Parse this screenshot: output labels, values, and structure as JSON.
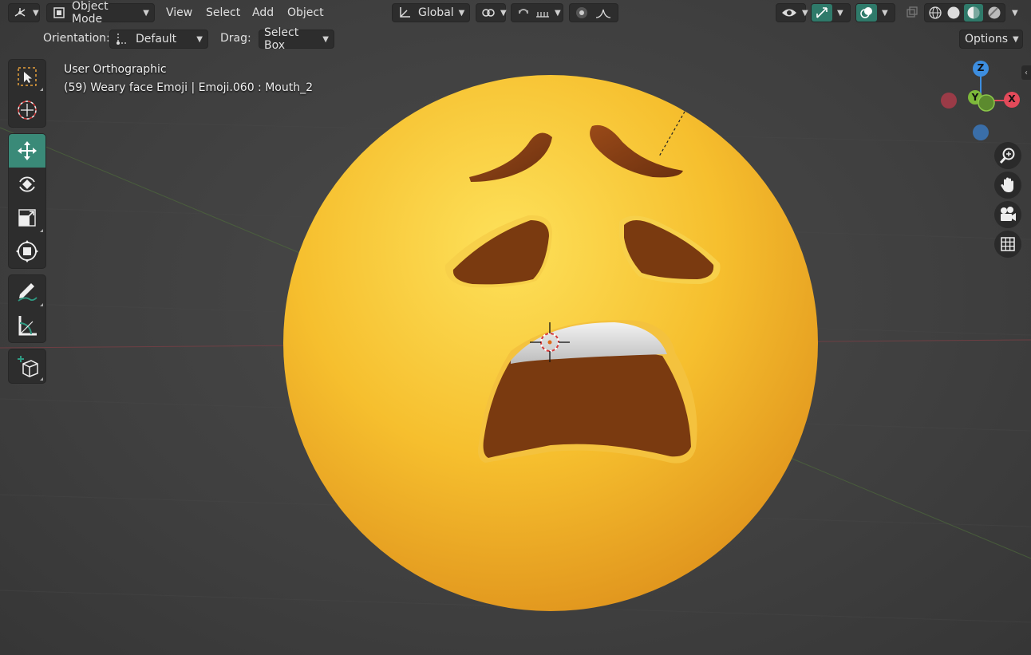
{
  "header": {
    "editor_type_icon": "viewport-editor-icon",
    "mode": "Object Mode",
    "menu": [
      "View",
      "Select",
      "Add",
      "Object"
    ],
    "transform_orientation": "Global",
    "icons": [
      "link-icon",
      "snap-magnet-icon",
      "snap-increment-icon",
      "proportional-edit-icon",
      "falloff-curve-icon",
      "visibility-eye-icon",
      "gizmo-icon",
      "overlay-icon",
      "xray-icon",
      "wireframe-shading-icon",
      "solid-shading-icon",
      "material-shading-icon",
      "rendered-shading-icon"
    ]
  },
  "tool_settings": {
    "orientation_label": "Orientation:",
    "orientation_value": "Default",
    "drag_label": "Drag:",
    "drag_value": "Select Box",
    "options_label": "Options"
  },
  "viewport_info": {
    "view_name": "User Orthographic",
    "object_info": "(59) Weary face Emoji | Emoji.060 : Mouth_2"
  },
  "toolbar": {
    "tools": [
      "select-box-icon",
      "cursor-icon",
      "move-icon",
      "rotate-icon",
      "scale-icon",
      "transform-icon",
      "annotate-icon",
      "measure-icon",
      "add-cube-icon"
    ],
    "active_tool": "move-icon"
  },
  "gizmo": {
    "axes": [
      "Z",
      "Y",
      "X"
    ],
    "colors": {
      "x": "#e34a5a",
      "y": "#7db83a",
      "z": "#3d8ee0"
    }
  },
  "nav_buttons": [
    "zoom-icon",
    "pan-hand-icon",
    "camera-icon",
    "ortho-grid-icon"
  ],
  "colors": {
    "accent": "#2f7a6a",
    "emoji_face": "#f2b632",
    "emoji_features": "#7a3a10"
  }
}
